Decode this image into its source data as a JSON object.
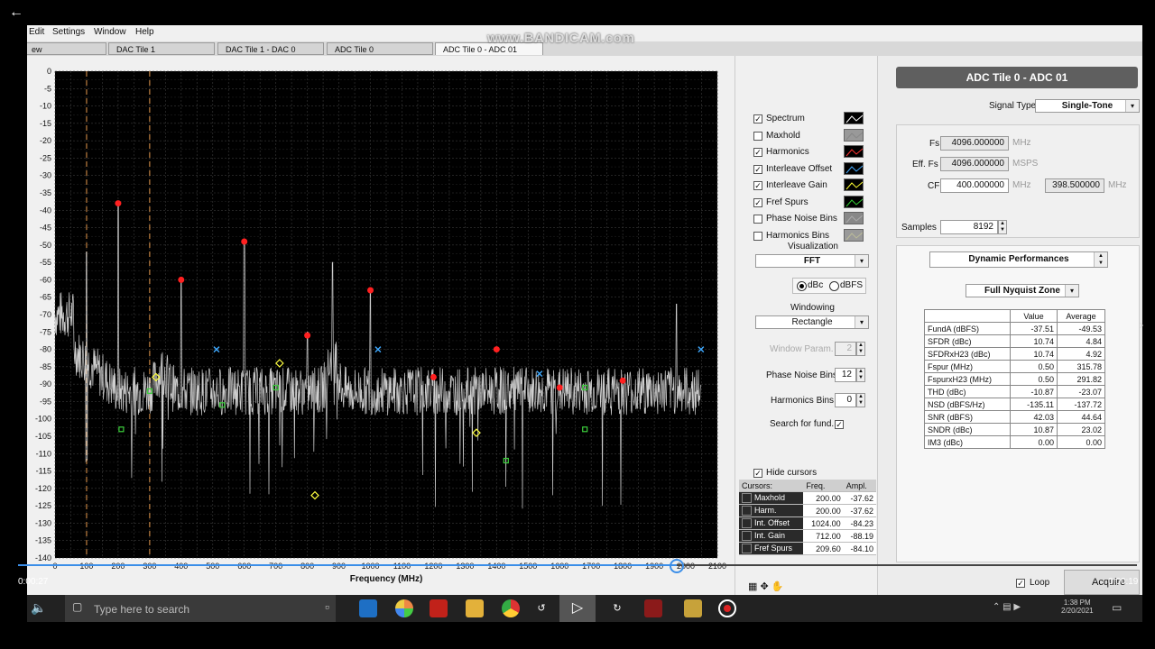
{
  "overlay": {
    "watermark": "www.BANDICAM.com",
    "time_left": "0:00:27",
    "time_right": "0:00:19"
  },
  "menu": [
    "Edit",
    "Settings",
    "Window",
    "Help"
  ],
  "tabs": [
    "ew",
    "DAC Tile 1",
    "DAC Tile 1 - DAC 0",
    "ADC Tile 0",
    "ADC Tile 0 - ADC 01"
  ],
  "checks": [
    {
      "label": "Spectrum",
      "checked": true
    },
    {
      "label": "Maxhold",
      "checked": false
    },
    {
      "label": "Harmonics",
      "checked": true
    },
    {
      "label": "Interleave Offset",
      "checked": true
    },
    {
      "label": "Interleave Gain",
      "checked": true
    },
    {
      "label": "Fref Spurs",
      "checked": true
    },
    {
      "label": "Phase Noise Bins",
      "checked": false
    },
    {
      "label": "Harmonics Bins",
      "checked": false
    }
  ],
  "mid": {
    "visualization_label": "Visualization",
    "visualization": "FFT",
    "dbc": "dBc",
    "dbfs": "dBFS",
    "windowing_label": "Windowing",
    "windowing": "Rectangle",
    "window_param_label": "Window Param.",
    "window_param": "2",
    "phase_noise_label": "Phase Noise Bins",
    "phase_noise": "12",
    "harmonics_bins_label": "Harmonics Bins",
    "harmonics_bins": "0",
    "search_label": "Search for fund.",
    "hide_cursors": "Hide cursors"
  },
  "cursors": {
    "headers": [
      "Cursors:",
      "Freq.",
      "Ampl."
    ],
    "rows": [
      {
        "name": "Maxhold",
        "freq": "200.00",
        "ampl": "-37.62"
      },
      {
        "name": "Harm.",
        "freq": "200.00",
        "ampl": "-37.62"
      },
      {
        "name": "Int. Offset",
        "freq": "1024.00",
        "ampl": "-84.23"
      },
      {
        "name": "Int. Gain",
        "freq": "712.00",
        "ampl": "-88.19"
      },
      {
        "name": "Fref Spurs",
        "freq": "209.60",
        "ampl": "-84.10"
      }
    ]
  },
  "right": {
    "title": "ADC Tile 0 - ADC 01",
    "signal_type_label": "Signal Type",
    "signal_type": "Single-Tone",
    "fs_label": "Fs",
    "fs": "4096.000000",
    "fs_unit": "MHz",
    "efs_label": "Eff. Fs",
    "efs": "4096.000000",
    "efs_unit": "MSPS",
    "cf_label": "CF",
    "cf": "400.000000",
    "cf_unit": "MHz",
    "cf2": "398.500000",
    "cf2_unit": "MHz",
    "samples_label": "Samples",
    "samples": "8192",
    "dp_select": "Dynamic Performances",
    "zone_select": "Full Nyquist Zone",
    "loop": "Loop",
    "acquire": "Acquire"
  },
  "dp_table": {
    "headers": [
      "",
      "Value",
      "Average"
    ],
    "rows": [
      [
        "FundA (dBFS)",
        "-37.51",
        "-49.53"
      ],
      [
        "SFDR (dBc)",
        "10.74",
        "4.84"
      ],
      [
        "SFDRxH23 (dBc)",
        "10.74",
        "4.92"
      ],
      [
        "Fspur (MHz)",
        "0.50",
        "315.78"
      ],
      [
        "FspurxH23 (MHz)",
        "0.50",
        "291.82"
      ],
      [
        "THD (dBc)",
        "-10.87",
        "-23.07"
      ],
      [
        "NSD (dBFS/Hz)",
        "-135.11",
        "-137.72"
      ],
      [
        "SNR (dBFS)",
        "42.03",
        "44.64"
      ],
      [
        "SNDR (dBc)",
        "10.87",
        "23.02"
      ],
      [
        "IM3 (dBc)",
        "0.00",
        "0.00"
      ]
    ]
  },
  "taskbar": {
    "search": "Type here to search",
    "clock_time": "1:38 PM",
    "clock_date": "2/20/2021"
  },
  "chart_data": {
    "type": "line",
    "xlabel": "Frequency (MHz)",
    "xlim": [
      0,
      2100
    ],
    "ylim": [
      -140,
      0
    ],
    "xticks": [
      0,
      100,
      200,
      300,
      400,
      500,
      600,
      700,
      800,
      900,
      1000,
      1100,
      1200,
      1300,
      1400,
      1500,
      1600,
      1700,
      1800,
      1900,
      2000,
      2100
    ],
    "yticks": [
      0,
      -5,
      -10,
      -15,
      -20,
      -25,
      -30,
      -35,
      -40,
      -45,
      -50,
      -55,
      -60,
      -65,
      -70,
      -75,
      -80,
      -85,
      -90,
      -95,
      -100,
      -105,
      -110,
      -115,
      -120,
      -125,
      -130,
      -135,
      -140
    ],
    "grid": true,
    "markers": {
      "dashed_lines_x": [
        100,
        300
      ]
    },
    "spectrum_peaks": [
      {
        "x": 100,
        "y": -52
      },
      {
        "x": 200,
        "y": -38
      },
      {
        "x": 400,
        "y": -60
      },
      {
        "x": 600,
        "y": -49
      },
      {
        "x": 800,
        "y": -75
      },
      {
        "x": 880,
        "y": -55
      },
      {
        "x": 1000,
        "y": -63
      },
      {
        "x": 1970,
        "y": -67
      }
    ],
    "harmonics": [
      {
        "x": 200,
        "y": -38
      },
      {
        "x": 400,
        "y": -60
      },
      {
        "x": 600,
        "y": -49
      },
      {
        "x": 800,
        "y": -76
      },
      {
        "x": 1000,
        "y": -63
      },
      {
        "x": 1200,
        "y": -88
      },
      {
        "x": 1400,
        "y": -80
      },
      {
        "x": 1600,
        "y": -91
      },
      {
        "x": 1800,
        "y": -89
      }
    ],
    "interleave_offset": [
      {
        "x": 512,
        "y": -80
      },
      {
        "x": 1024,
        "y": -80
      },
      {
        "x": 1536,
        "y": -87
      },
      {
        "x": 2048,
        "y": -80
      }
    ],
    "interleave_gain": [
      {
        "x": 320,
        "y": -88
      },
      {
        "x": 712,
        "y": -84
      },
      {
        "x": 824,
        "y": -122
      },
      {
        "x": 1336,
        "y": -104
      }
    ],
    "fref_spurs": [
      {
        "x": 210,
        "y": -103
      },
      {
        "x": 300,
        "y": -92
      },
      {
        "x": 530,
        "y": -96
      },
      {
        "x": 700,
        "y": -91
      },
      {
        "x": 1430,
        "y": -112
      },
      {
        "x": 1680,
        "y": -91
      },
      {
        "x": 1680,
        "y": -103
      }
    ],
    "noise_floor": -92
  }
}
